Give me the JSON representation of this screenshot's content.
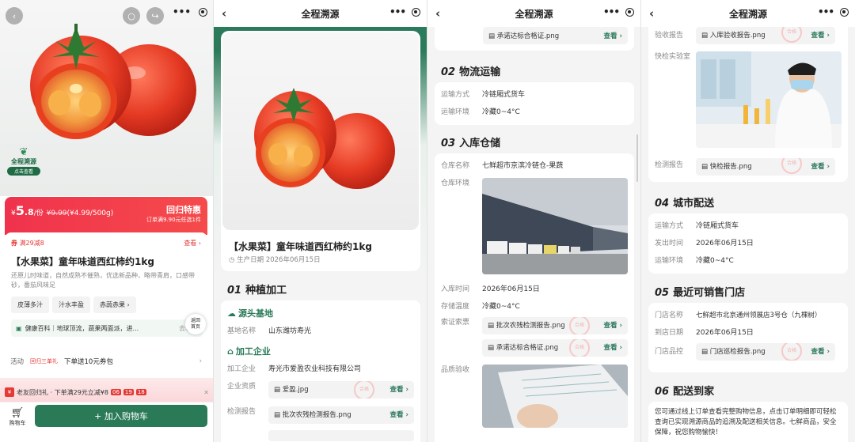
{
  "colors": {
    "brand_green": "#2a7a58",
    "price_red": "#f0324d"
  },
  "screen1": {
    "capsule": {
      "more": "•••"
    },
    "trace_badge": {
      "title": "全程溯源",
      "cta": "点击查看"
    },
    "price": {
      "currency": "¥",
      "int": "5",
      "dec": ".8",
      "unit": "/份",
      "old": "¥9.99",
      "per": "(¥4.99/500g)",
      "promo_title": "回归特惠",
      "promo_sub": "订单满9.90元任选1件"
    },
    "coupon": {
      "tag": "券",
      "label": "满29减8",
      "view": "查看 ›"
    },
    "product": {
      "title": "【水果菜】童年味道西红柿约1kg",
      "desc": "还原儿时味道，自然成熟不催熟，优选新品种，略带青肩，口感带砂，番茄风味足"
    },
    "tags": [
      "皮薄多汁",
      "汁水丰盈",
      "赤蔬赤果"
    ],
    "wiki": {
      "label": "健康百科｜地球顶流，蔬果两面派，进...",
      "more": "去看看"
    },
    "fab": {
      "l1": "返回",
      "l2": "首页"
    },
    "activity": {
      "label": "活动",
      "tag": "回归三单礼",
      "text": "下单送10元券包",
      "chev": "›"
    },
    "promo": {
      "icon": "¥",
      "text": "老友回归礼 · 下单满29元立减¥8",
      "t1": "06",
      "t2": "19",
      "t3": "18",
      "close": "✕"
    },
    "cart": {
      "label": "购物车",
      "add": "+ 加入购物车"
    }
  },
  "screen2": {
    "title": "全程溯源",
    "product_title": "【水果菜】童年味道西红柿约1kg",
    "produce_date": "生产日期  2026年06月15日",
    "stage1": {
      "num": "01",
      "title": "种植加工"
    },
    "base": {
      "title": "源头基地",
      "rows": [
        {
          "k": "基地名称",
          "v": "山东潍坊寿光"
        }
      ]
    },
    "proc": {
      "title": "加工企业",
      "rows": [
        {
          "k": "加工企业",
          "v": "寿光市爱盈农业科技有限公司"
        }
      ]
    },
    "qual": {
      "k": "企业资质",
      "file": "爱盈.jpg",
      "view": "查看 ›"
    },
    "test": {
      "k": "检测报告",
      "file": "批次农残检测报告.png",
      "view": "查看 ›"
    }
  },
  "screen3": {
    "title": "全程溯源",
    "top_file": {
      "name": "承诺达标合格证.png",
      "view": "查看 ›"
    },
    "s2": {
      "num": "02",
      "title": "物流运输",
      "rows": [
        {
          "k": "运输方式",
          "v": "冷链厢式货车"
        },
        {
          "k": "运输环境",
          "v": "冷藏0~4°C"
        }
      ]
    },
    "s3": {
      "num": "03",
      "title": "入库仓储",
      "rows": [
        {
          "k": "仓库名称",
          "v": "七鲜超市京滨冷链仓-果蔬"
        }
      ],
      "env_k": "仓库环境",
      "rows2": [
        {
          "k": "入库时间",
          "v": "2026年06月15日"
        },
        {
          "k": "存储温度",
          "v": "冷藏0~4°C"
        }
      ],
      "cert_k": "索证索票",
      "f1": "批次农残检测报告.png",
      "f2": "承诺达标合格证.png",
      "view": "查看 ›",
      "qc_k": "品质验收"
    }
  },
  "screen4": {
    "title": "全程溯源",
    "accept": {
      "k": "验收报告",
      "file": "入库验收报告.png",
      "view": "查看 ›"
    },
    "lab_k": "快检实验室",
    "qreport": {
      "k": "检测报告",
      "file": "快检报告.png",
      "view": "查看 ›"
    },
    "s4": {
      "num": "04",
      "title": "城市配送",
      "rows": [
        {
          "k": "运输方式",
          "v": "冷链厢式货车"
        },
        {
          "k": "发出时间",
          "v": "2026年06月15日"
        },
        {
          "k": "运输环境",
          "v": "冷藏0~4°C"
        }
      ]
    },
    "s5": {
      "num": "05",
      "title": "最近可销售门店",
      "rows": [
        {
          "k": "门店名称",
          "v": "七鲜超市北京通州领展店3号仓（九棵树）"
        },
        {
          "k": "到店日期",
          "v": "2026年06月15日"
        }
      ],
      "ctrl_k": "门店品控",
      "file": "门店巡检报告.png",
      "view": "查看 ›"
    },
    "s6": {
      "num": "06",
      "title": "配送到家",
      "text": "您可通过线上订单查看完整购物信息，点击订单明细即可轻松查询已实现溯源商品的追溯及配送相关信息。七鲜商品，安全保障，祝您购物愉快！"
    }
  }
}
